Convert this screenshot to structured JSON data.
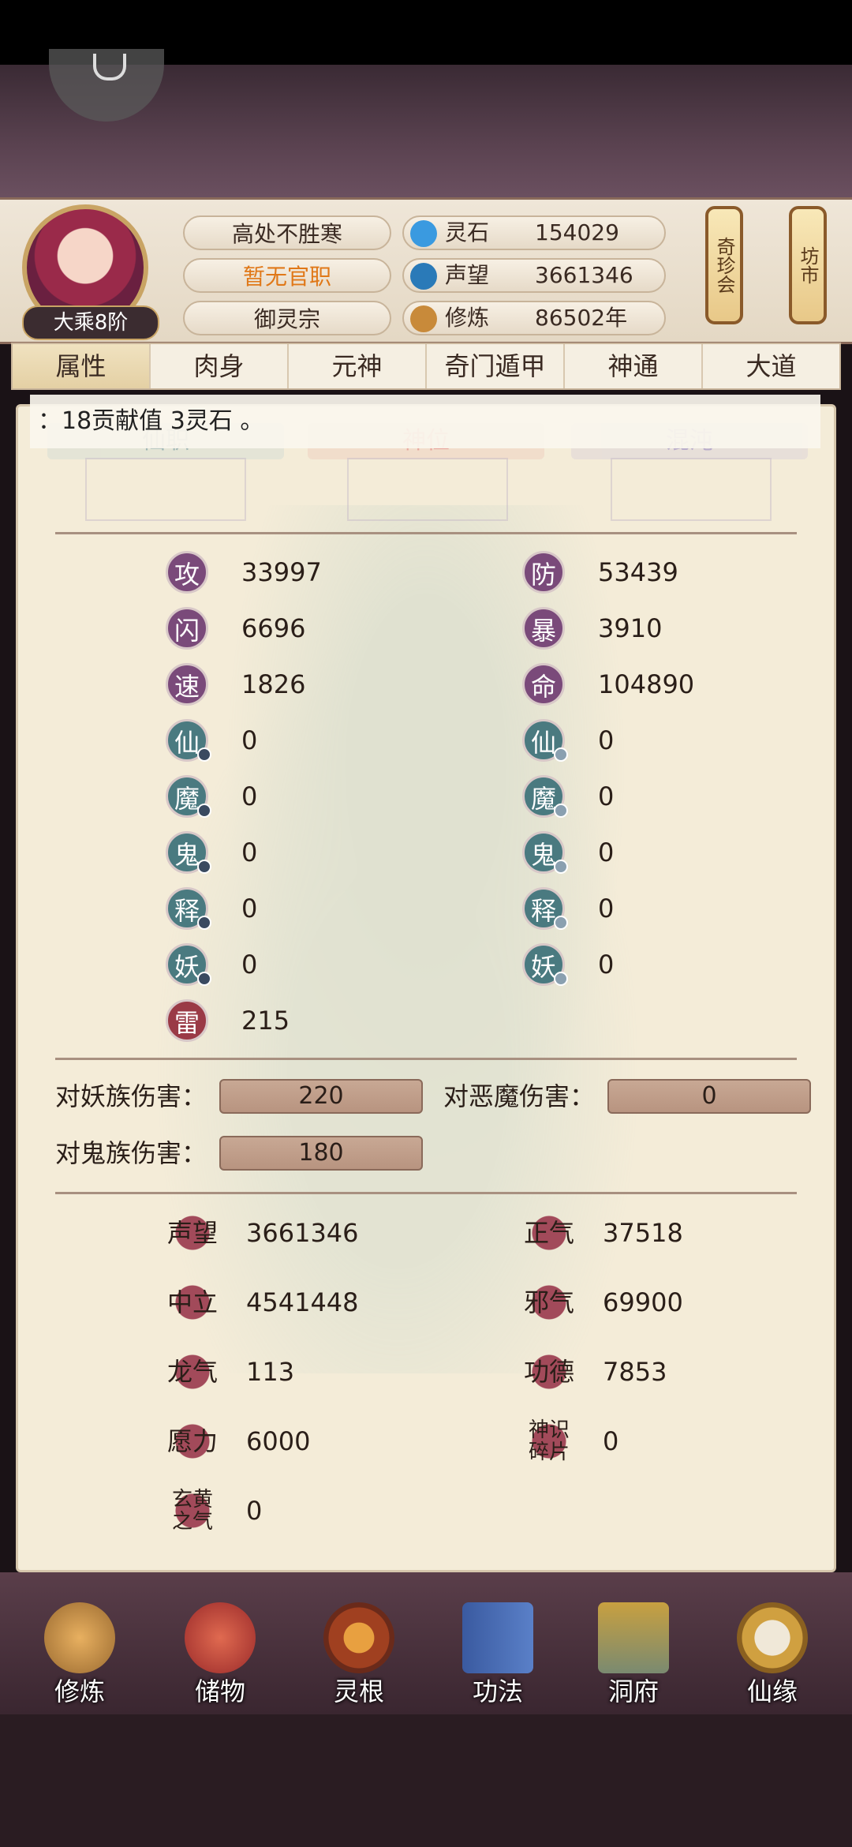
{
  "player": {
    "title": "高处不胜寒",
    "official_post": "暂无官职",
    "sect": "御灵宗",
    "rank": "大乘8阶"
  },
  "resources": [
    {
      "label": "灵石",
      "value": "154029",
      "icon": "spirit-stone-icon"
    },
    {
      "label": "声望",
      "value": "3661346",
      "icon": "prestige-icon"
    },
    {
      "label": "修炼",
      "value": "86502年",
      "icon": "cultivation-icon"
    }
  ],
  "side_buttons": {
    "treasure": "奇珍会",
    "market": "坊市"
  },
  "tabs": [
    "属性",
    "肉身",
    "元神",
    "奇门遁甲",
    "神通",
    "大道"
  ],
  "active_tab": "属性",
  "tooltip": "：18贡献值 3灵石 。",
  "rank_tabs": [
    "仙职",
    "神位",
    "混沌"
  ],
  "stats_left": [
    {
      "label": "攻",
      "value": "33997"
    },
    {
      "label": "闪",
      "value": "6696"
    },
    {
      "label": "速",
      "value": "1826"
    },
    {
      "label": "仙",
      "value": "0"
    },
    {
      "label": "魔",
      "value": "0"
    },
    {
      "label": "鬼",
      "value": "0"
    },
    {
      "label": "释",
      "value": "0"
    },
    {
      "label": "妖",
      "value": "0"
    },
    {
      "label": "雷",
      "value": "215"
    }
  ],
  "stats_right": [
    {
      "label": "防",
      "value": "53439"
    },
    {
      "label": "暴",
      "value": "3910"
    },
    {
      "label": "命",
      "value": "104890"
    },
    {
      "label": "仙",
      "value": "0"
    },
    {
      "label": "魔",
      "value": "0"
    },
    {
      "label": "鬼",
      "value": "0"
    },
    {
      "label": "释",
      "value": "0"
    },
    {
      "label": "妖",
      "value": "0"
    }
  ],
  "damage": [
    {
      "label": "对妖族伤害：",
      "value": "220"
    },
    {
      "label": "对恶魔伤害：",
      "value": "0"
    },
    {
      "label": "对鬼族伤害：",
      "value": "180"
    }
  ],
  "reputation_left": [
    {
      "label": "声望",
      "value": "3661346"
    },
    {
      "label": "中立",
      "value": "4541448"
    },
    {
      "label": "龙气",
      "value": "113"
    },
    {
      "label": "愿力",
      "value": "6000"
    },
    {
      "label": "玄黄之气",
      "value": "0"
    }
  ],
  "reputation_right": [
    {
      "label": "正气",
      "value": "37518"
    },
    {
      "label": "邪气",
      "value": "69900"
    },
    {
      "label": "功德",
      "value": "7853"
    },
    {
      "label": "神识碎片",
      "value": "0"
    }
  ],
  "bottom_nav": [
    "修炼",
    "储物",
    "灵根",
    "功法",
    "洞府",
    "仙缘"
  ]
}
